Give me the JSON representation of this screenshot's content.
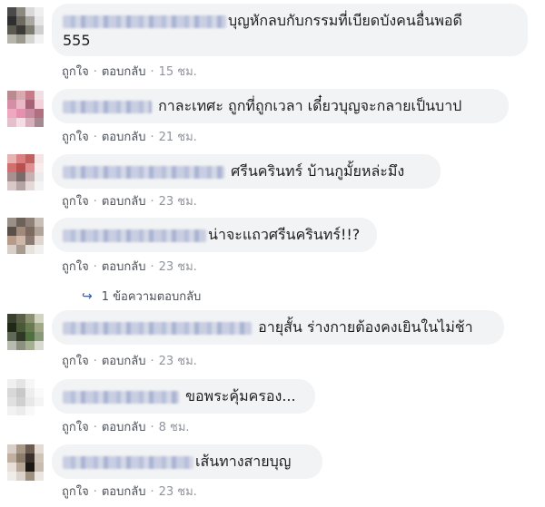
{
  "comments": [
    {
      "text_before": "",
      "text": "บุญหักลบกับกรรมที่เบียดบังคนอื่นพอดี",
      "text_line2": "555",
      "like": "ถูกใจ",
      "reply": "ตอบกลับ",
      "time": "15 ชม."
    },
    {
      "text": "กาละเทศะ ถูกที่ถูกเวลา เดี๋ยวบุญจะกลายเป็นบาป",
      "like": "ถูกใจ",
      "reply": "ตอบกลับ",
      "time": "21 ชม."
    },
    {
      "text": "ศรีนครินทร์ บ้านกูมั้ยหล่ะมึง",
      "like": "ถูกใจ",
      "reply": "ตอบกลับ",
      "time": "23 ชม."
    },
    {
      "text": "น่าจะแถวศรีนครินทร์!!?",
      "like": "ถูกใจ",
      "reply": "ตอบกลับ",
      "time": "23 ชม."
    },
    {
      "text": "อายุสั้น ร่างกายต้องคงเยินในไม่ช้า",
      "like": "ถูกใจ",
      "reply": "ตอบกลับ",
      "time": "23 ชม."
    },
    {
      "text": "ขอพระคุ้มครอง...",
      "like": "ถูกใจ",
      "reply": "ตอบกลับ",
      "time": "8 ชม."
    },
    {
      "text": "เส้นทางสายบุญ",
      "like": "ถูกใจ",
      "reply": "ตอบกลับ",
      "time": "23 ชม."
    }
  ],
  "reply_thread": {
    "label": "1 ข้อความตอบกลับ",
    "icon": "reply-arrow-icon"
  },
  "colors": {
    "bubble": "#f2f3f5",
    "meta": "#90949c",
    "link": "#385898"
  }
}
